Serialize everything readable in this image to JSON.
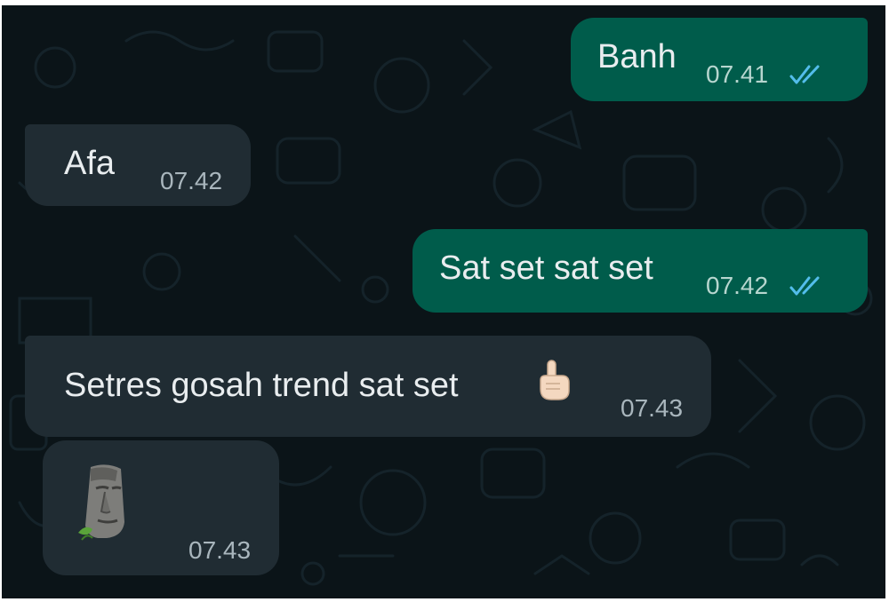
{
  "messages": [
    {
      "id": "m1",
      "direction": "outgoing",
      "text": "Banh",
      "time": "07.41",
      "status": "read"
    },
    {
      "id": "m2",
      "direction": "incoming",
      "text": "Afa",
      "time": "07.42"
    },
    {
      "id": "m3",
      "direction": "outgoing",
      "text": "Sat set sat set",
      "time": "07.42",
      "status": "read"
    },
    {
      "id": "m4",
      "direction": "incoming",
      "text": "Setres gosah trend sat set",
      "emoji": "pointing-up-emoji",
      "time": "07.43"
    },
    {
      "id": "m5",
      "direction": "incoming",
      "sticker": "moai-sticker",
      "time": "07.43"
    }
  ],
  "colors": {
    "background": "#0b1418",
    "outgoing_bubble": "#005c4b",
    "incoming_bubble": "#202c33",
    "text": "#e9edef",
    "read_ticks": "#53bdeb"
  }
}
